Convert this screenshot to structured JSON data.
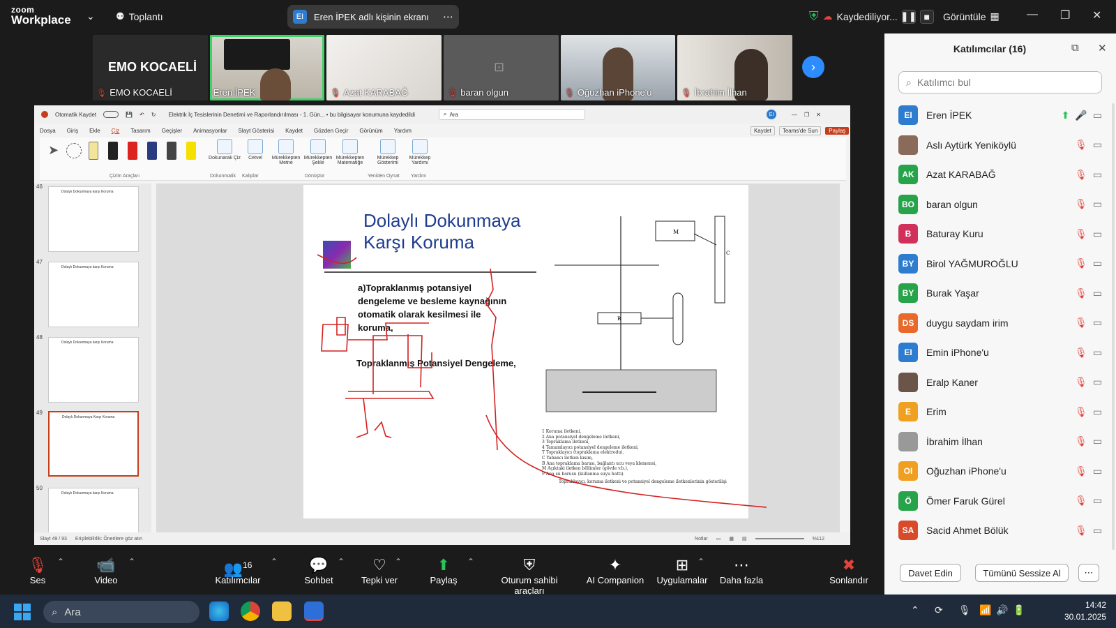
{
  "topbar": {
    "logo_small": "zoom",
    "logo_big": "Workplace",
    "meeting_label": "Toplantı",
    "share_badge": "EI",
    "share_title": "Eren İPEK adlı kişinin ekranı",
    "recording_label": "Kaydediliyor...",
    "view_label": "Görüntüle"
  },
  "video_strip": [
    {
      "name": "EMO KOCAELİ",
      "big_text": "EMO KOCAELİ"
    },
    {
      "name": "Eren İPEK"
    },
    {
      "name": "Azat KARABAĞ"
    },
    {
      "name": "baran  olgun"
    },
    {
      "name": "Oğuzhan iPhone'u"
    },
    {
      "name": "İbrahim İlhan"
    }
  ],
  "ppt": {
    "autosave": "Otomatik Kaydet",
    "doc_title": "Elektrik İç Tesislerinin Denetimi ve Raporlandırılması - 1. Gün... • bu bilgisayar konumuna kaydedildi",
    "search": "Ara",
    "menu": [
      "Dosya",
      "Giriş",
      "Ekle",
      "Çiz",
      "Tasarım",
      "Geçişler",
      "Animasyonlar",
      "Slayt Gösterisi",
      "Kaydet",
      "Gözden Geçir",
      "Görünüm",
      "Yardım"
    ],
    "right_buttons": [
      "Kaydet",
      "Teams'de Sun",
      "Paylaş"
    ],
    "ribbon": [
      "Dokunarak Çiz",
      "Cetvel",
      "Mürekkepten Metne",
      "Mürekkepten Şekle",
      "Mürekkepten Matematiğe",
      "Mürekkep Gösterimi",
      "Mürekkep Yardımı"
    ],
    "ribbon_groups": [
      "Çizim Araçları",
      "Dokunmatik",
      "Kalıplar",
      "Dönüştür",
      "Yeniden Oynat",
      "Yardım"
    ],
    "thumb_numbers": [
      "46",
      "47",
      "48",
      "49",
      "50"
    ],
    "thumb_titles": [
      "Dolaylı Dokunmaya karşı Koruma",
      "Dolaylı Dokunmaya karşı Koruma",
      "Dolaylı Dokunmaya karşı Koruma",
      "Dolaylı Dokunmaya Karşı Koruma",
      "Dolaylı Dokunmaya karşı Koruma"
    ],
    "slide_title_1": "Dolaylı Dokunmaya",
    "slide_title_2": "Karşı Koruma",
    "body_1": "a)Topraklanmış potansiyel",
    "body_2": "dengeleme ve besleme kaynağının",
    "body_3": "otomatik olarak kesilmesi ile",
    "body_4": "koruma,",
    "body_5": "Topraklanmış Potansiyel Dengeleme,",
    "legend": [
      "1   Koruma iletkeni,",
      "2   Ana potansiyel dengeleme iletkeni,",
      "3   Topraklama iletkeni,",
      "4   Tamamlayıcı potansiyel dengeleme iletkeni,",
      "T   Topraklayıcı (topraklama elektrodu),",
      "C   Yabancı iletken kısım,",
      "B   Ana topraklama barası, bağlantı ucu veya klemensi,",
      "M   Açıktaki iletken bölümler (gövde v.b.),",
      "P   Ana su borusu (kullanma suyu hattı)."
    ],
    "legend_caption": "Topraklayıcı, koruma iletkeni ve potansiyel dengeleme iletkenlerinin gösterilişi",
    "status_left": "Slayt 49 / 93",
    "status_access": "Erişilebilirlik: Önerilere göz atın",
    "status_notes": "Notlar",
    "status_zoom": "%112"
  },
  "participants": {
    "title": "Katılımcılar (16)",
    "search_placeholder": "Katılımcı bul",
    "list": [
      {
        "initials": "EI",
        "name": "Eren İPEK",
        "color": "#2d7ccf",
        "muted": false
      },
      {
        "initials": "",
        "name": "Aslı Aytürk Yeniköylü",
        "color": "#8a6a5a",
        "muted": true
      },
      {
        "initials": "AK",
        "name": "Azat KARABAĞ",
        "color": "#27a34a",
        "muted": true
      },
      {
        "initials": "BO",
        "name": "baran  olgun",
        "color": "#27a34a",
        "muted": true
      },
      {
        "initials": "B",
        "name": "Baturay Kuru",
        "color": "#d0305a",
        "muted": true
      },
      {
        "initials": "BY",
        "name": "Birol YAĞMUROĞLU",
        "color": "#2d7ccf",
        "muted": true
      },
      {
        "initials": "BY",
        "name": "Burak Yaşar",
        "color": "#27a34a",
        "muted": true
      },
      {
        "initials": "DS",
        "name": "duygu saydam irim",
        "color": "#e8692a",
        "muted": true
      },
      {
        "initials": "EI",
        "name": "Emin iPhone'u",
        "color": "#2d7ccf",
        "muted": true
      },
      {
        "initials": "",
        "name": "Eralp Kaner",
        "color": "#6b5548",
        "muted": true
      },
      {
        "initials": "E",
        "name": "Erim",
        "color": "#f0a020",
        "muted": true
      },
      {
        "initials": "",
        "name": "İbrahim İlhan",
        "color": "#999999",
        "muted": true
      },
      {
        "initials": "OI",
        "name": "Oğuzhan iPhone'u",
        "color": "#f0a020",
        "muted": true
      },
      {
        "initials": "Ö",
        "name": "Ömer Faruk Gürel",
        "color": "#27a34a",
        "muted": true
      },
      {
        "initials": "SA",
        "name": "Sacid Ahmet Bölük",
        "color": "#d84a2a",
        "muted": true
      }
    ],
    "invite_button": "Davet Edin",
    "mute_all_button": "Tümünü Sessize Al"
  },
  "toolbar": {
    "audio": "Ses",
    "video": "Video",
    "participants": "Katılımcılar",
    "participants_count": "16",
    "chat": "Sohbet",
    "react": "Tepki ver",
    "share": "Paylaş",
    "host_tools": "Oturum sahibi araçları",
    "ai": "AI Companion",
    "apps": "Uygulamalar",
    "more": "Daha fazla",
    "end": "Sonlandır"
  },
  "taskbar": {
    "search": "Ara",
    "time": "14:42",
    "date": "30.01.2025"
  }
}
